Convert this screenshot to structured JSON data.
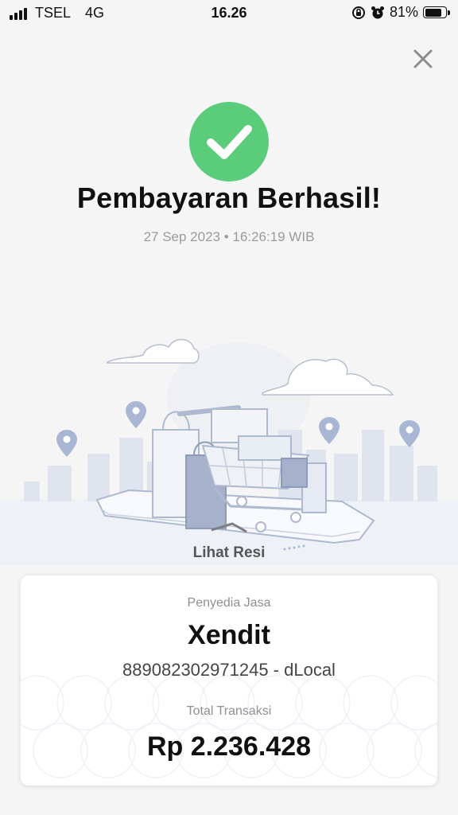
{
  "status_bar": {
    "carrier": "TSEL",
    "network": "4G",
    "time": "16.26",
    "battery_percent": "81%",
    "battery_level": 0.81,
    "icons": [
      "signal-icon",
      "orientation-lock-icon",
      "alarm-icon",
      "battery-icon"
    ]
  },
  "header": {
    "close_icon": "close-icon"
  },
  "success": {
    "icon": "checkmark-icon",
    "icon_color": "#5bcc7a",
    "title": "Pembayaran Berhasil!",
    "datetime": "27 Sep 2023 • 16:26:19 WIB"
  },
  "illustration": {
    "name": "shopping-cart-illustration"
  },
  "receipt_link": {
    "label": "Lihat Resi"
  },
  "card": {
    "provider_label": "Penyedia Jasa",
    "provider_name": "Xendit",
    "reference": "889082302971245 - dLocal",
    "total_label": "Total Transaksi",
    "total_amount": "Rp 2.236.428"
  }
}
